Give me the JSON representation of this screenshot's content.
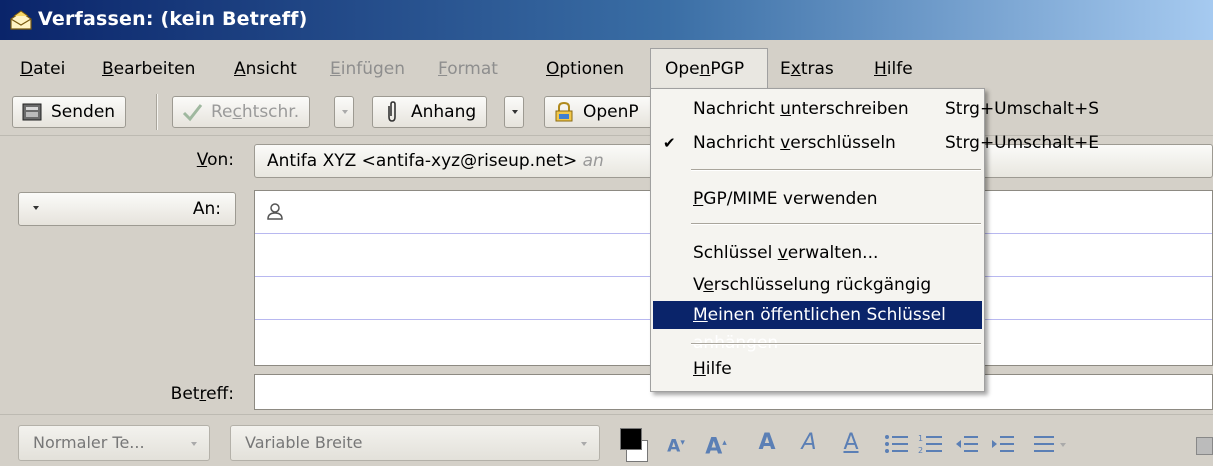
{
  "window": {
    "title": "Verfassen: (kein Betreff)"
  },
  "menubar": {
    "items": [
      {
        "label": "Datei",
        "ak": "D",
        "rest": "atei",
        "pre": "",
        "disabled": false
      },
      {
        "label": "Bearbeiten",
        "pre": "",
        "ak": "B",
        "rest": "earbeiten",
        "disabled": false
      },
      {
        "label": "Ansicht",
        "pre": "",
        "ak": "A",
        "rest": "nsicht",
        "disabled": false
      },
      {
        "label": "Einfügen",
        "pre": "",
        "ak": "E",
        "rest": "infügen",
        "disabled": true
      },
      {
        "label": "Format",
        "pre": "",
        "ak": "F",
        "rest": "ormat",
        "disabled": true
      },
      {
        "label": "Optionen",
        "pre": "",
        "ak": "O",
        "rest": "ptionen",
        "disabled": false
      },
      {
        "label": "OpenPGP",
        "pre": "Ope",
        "ak": "n",
        "rest": "PGP",
        "disabled": false,
        "open": true
      },
      {
        "label": "Extras",
        "pre": "E",
        "ak": "x",
        "rest": "tras",
        "disabled": false
      },
      {
        "label": "Hilfe",
        "pre": "",
        "ak": "H",
        "rest": "ilfe",
        "disabled": false
      }
    ]
  },
  "toolbar": {
    "send_label": "Senden",
    "spell_pre": "Re",
    "spell_ak": "c",
    "spell_rest": "htschr.",
    "attach_label": "Anhang",
    "openpgp_label": "OpenP"
  },
  "address": {
    "from_label_ak": "V",
    "from_label_rest": "on:",
    "from_value": "Antifa XYZ <antifa-xyz@riseup.net>",
    "from_hint": "an",
    "to_label": "An:",
    "subject_label_pre": "Bet",
    "subject_label_ak": "r",
    "subject_label_rest": "eff:"
  },
  "formatbar": {
    "paragraph_format": "Normaler Te...",
    "font": "Variable Breite"
  },
  "openpgp_menu": {
    "items": [
      {
        "pre": "Nachricht ",
        "ak": "u",
        "rest": "nterschreiben",
        "accel": "Strg+Umschalt+S",
        "checked": false
      },
      {
        "pre": "Nachricht ",
        "ak": "v",
        "rest": "erschlüsseln",
        "accel": "Strg+Umschalt+E",
        "checked": true
      },
      {
        "pre": "",
        "ak": "P",
        "rest": "GP/MIME verwenden",
        "accel": "",
        "checked": false
      },
      {
        "pre": "Schlüssel ",
        "ak": "v",
        "rest": "erwalten...",
        "accel": "",
        "checked": false
      },
      {
        "pre": "V",
        "ak": "e",
        "rest": "rschlüsselung rückgängig machen",
        "accel": "",
        "checked": false
      },
      {
        "pre": "",
        "ak": "M",
        "rest": "einen öffentlichen Schlüssel anhängen",
        "accel": "",
        "checked": false,
        "highlighted": true
      },
      {
        "pre": "",
        "ak": "H",
        "rest": "ilfe",
        "accel": "",
        "checked": false
      }
    ]
  },
  "colors": {
    "menu_highlight": "#0a246a",
    "title_gradient_start": "#0a246a",
    "title_gradient_end": "#a6caf0"
  }
}
